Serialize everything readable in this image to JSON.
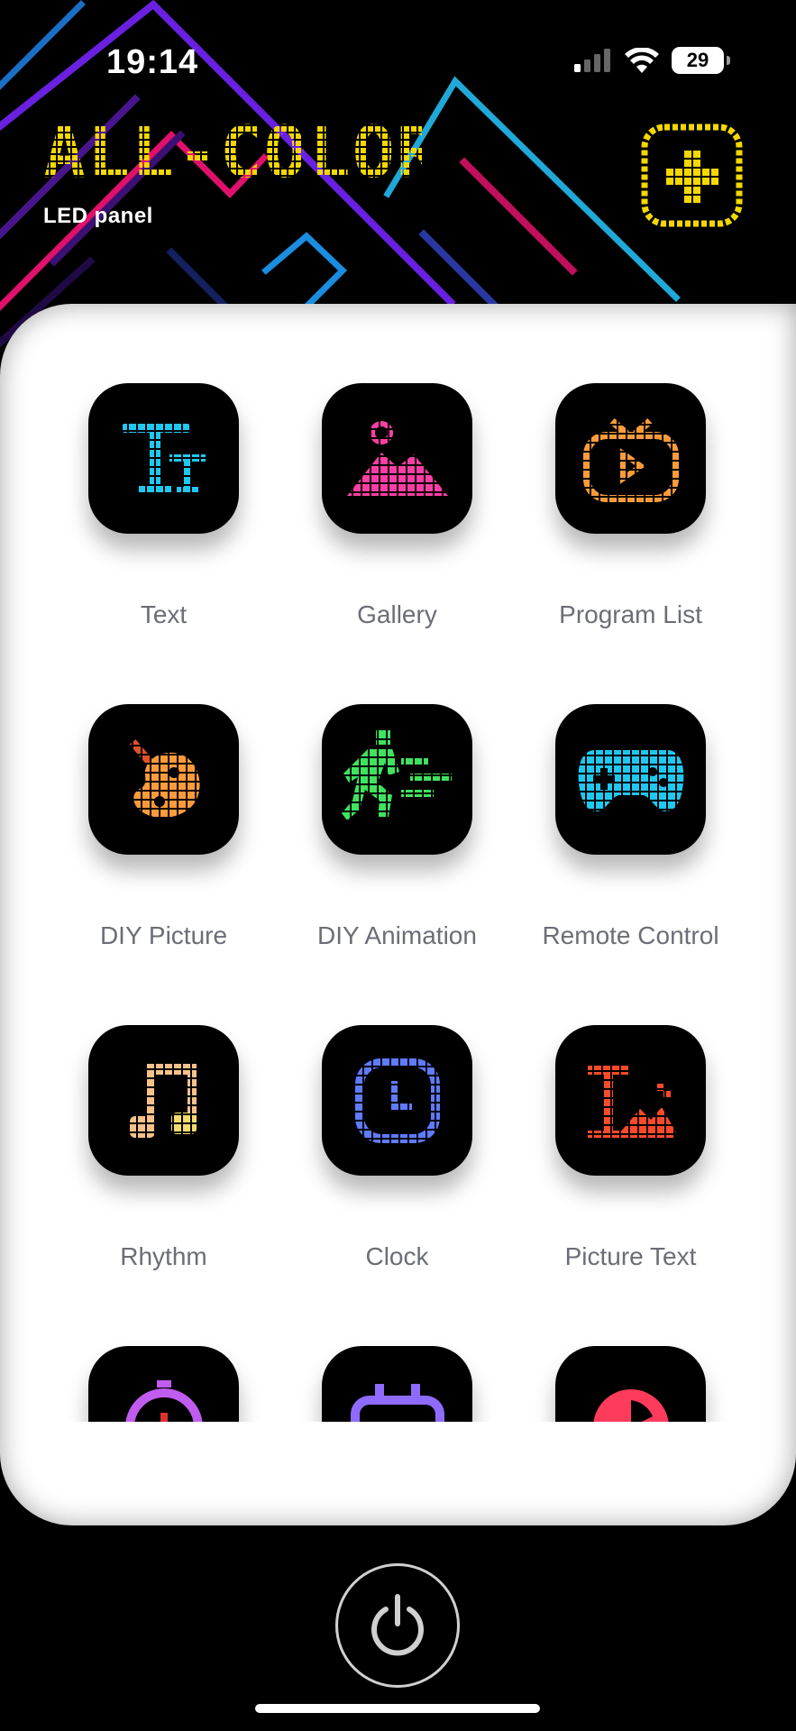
{
  "status_bar": {
    "time": "19:14",
    "battery_level": "29",
    "signal_icon": "cellular-signal-icon",
    "wifi_icon": "wifi-icon"
  },
  "header": {
    "logo_text": "ALL-COLOR",
    "subtitle": "LED panel",
    "add_button_icon": "plus-icon"
  },
  "colors": {
    "logo_yellow": "#f5d800",
    "card_background": "#ffffff",
    "label_gray": "#6b6e76"
  },
  "tiles": [
    {
      "label": "Text",
      "icon": "text-icon",
      "color": "#1ec8f0"
    },
    {
      "label": "Gallery",
      "icon": "gallery-icon",
      "color": "#ff3ea5"
    },
    {
      "label": "Program List",
      "icon": "tv-icon",
      "color": "#ff9b3a"
    },
    {
      "label": "DIY Picture",
      "icon": "palette-icon",
      "color": "#ff9b3a"
    },
    {
      "label": "DIY Animation",
      "icon": "running-man-icon",
      "color": "#3fe35e"
    },
    {
      "label": "Remote Control",
      "icon": "gamepad-icon",
      "color": "#1ec8f0"
    },
    {
      "label": "Rhythm",
      "icon": "music-note-icon",
      "color": "#f7c18a"
    },
    {
      "label": "Clock",
      "icon": "clock-icon",
      "color": "#5f7bff"
    },
    {
      "label": "Picture Text",
      "icon": "picture-text-icon",
      "color": "#ff4a2a"
    },
    {
      "label": "",
      "icon": "stopwatch-icon",
      "color": "#c15cf0"
    },
    {
      "label": "",
      "icon": "alarm-icon",
      "color": "#8f6aff"
    },
    {
      "label": "",
      "icon": "pie-icon",
      "color": "#ff3b5c"
    }
  ],
  "bottom": {
    "power_icon": "power-icon"
  }
}
